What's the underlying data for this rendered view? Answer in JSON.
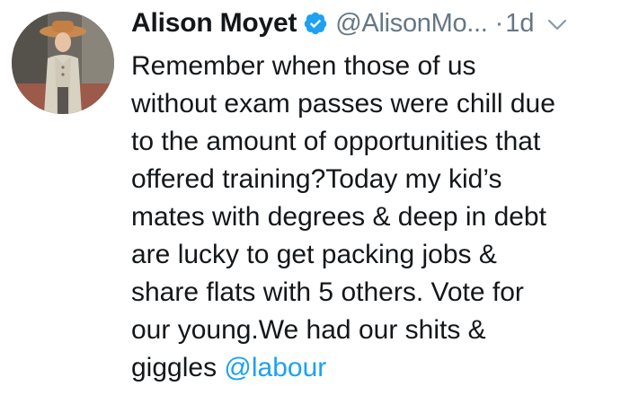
{
  "tweet": {
    "author": {
      "display_name": "Alison Moyet",
      "verified_icon": "verified-badge-icon",
      "handle": "@AlisonMo...",
      "avatar_icon": "profile-photo"
    },
    "separator": "·",
    "timestamp": "1d",
    "menu_icon": "chevron-down-icon",
    "text_lines": [
      "Remember when those of us",
      "without exam passes were chill due",
      "to the amount of opportunities that",
      "offered training?Today my kid’s",
      "mates with degrees & deep in debt",
      "are lucky to get packing jobs &",
      "share flats with 5 others. Vote for",
      "our young.We had our shits &",
      "giggles "
    ],
    "mention": "@labour"
  },
  "colors": {
    "text": "#14171a",
    "secondary": "#657786",
    "link": "#1da1f2",
    "verified": "#1da1f2"
  }
}
